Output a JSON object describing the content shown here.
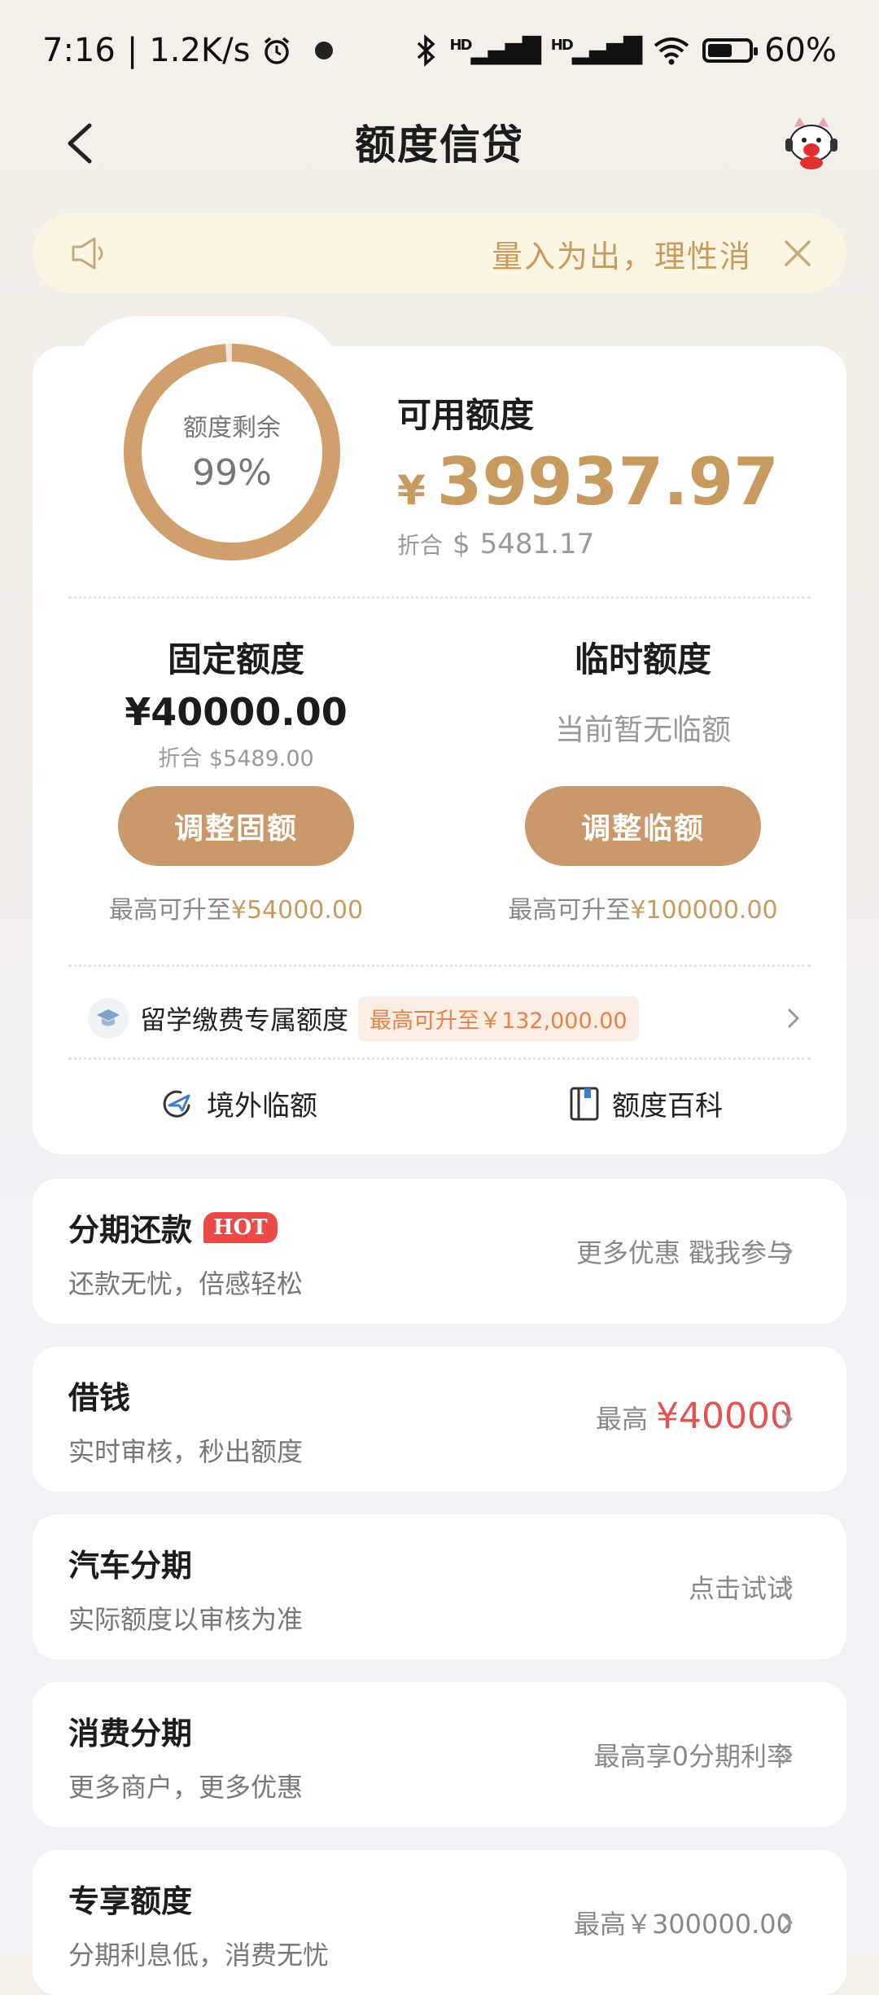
{
  "status_bar": {
    "time": "7:16",
    "net_speed": "1.2K/s",
    "signal_1": "HD",
    "signal_2": "HD",
    "battery_fill": 0.6,
    "battery_text": "60%"
  },
  "header": {
    "title": "额度信贷"
  },
  "notice": {
    "text": "量入为出，理性消"
  },
  "credit": {
    "ring_label": "额度剩余",
    "ring_value": "99%",
    "ring_fraction": 0.99,
    "available_title": "可用额度",
    "currency_symbol": "¥",
    "available_amount": "39937.97",
    "converted_label": "折合",
    "converted_currency": "$",
    "converted_amount": "5481.17",
    "fixed": {
      "title": "固定额度",
      "amount": "¥40000.00",
      "converted": "折合 $5489.00",
      "button": "调整固额",
      "max_prefix": "最高可升至",
      "max_value": "¥54000.00"
    },
    "temp": {
      "title": "临时额度",
      "empty_text": "当前暂无临额",
      "button": "调整临额",
      "max_prefix": "最高可升至",
      "max_value": "¥100000.00"
    },
    "study": {
      "label": "留学缴费专属额度",
      "tag": "最高可升至￥132,000.00"
    },
    "links": {
      "overseas": "境外临额",
      "wiki": "额度百科"
    }
  },
  "list": [
    {
      "title": "分期还款",
      "badge": "HOT",
      "sub": "还款无忧，倍感轻松",
      "right": "更多优惠 戳我参与"
    },
    {
      "title": "借钱",
      "sub": "实时审核，秒出额度",
      "right_prefix": "最高",
      "right_red": "¥40000"
    },
    {
      "title": "汽车分期",
      "sub": "实际额度以审核为准",
      "right": "点击试试"
    },
    {
      "title": "消费分期",
      "sub": "更多商户，更多优惠",
      "right": "最高享0分期利率"
    },
    {
      "title": "专享额度",
      "sub": "分期利息低，消费无忧",
      "right": "最高￥300000.00"
    }
  ]
}
